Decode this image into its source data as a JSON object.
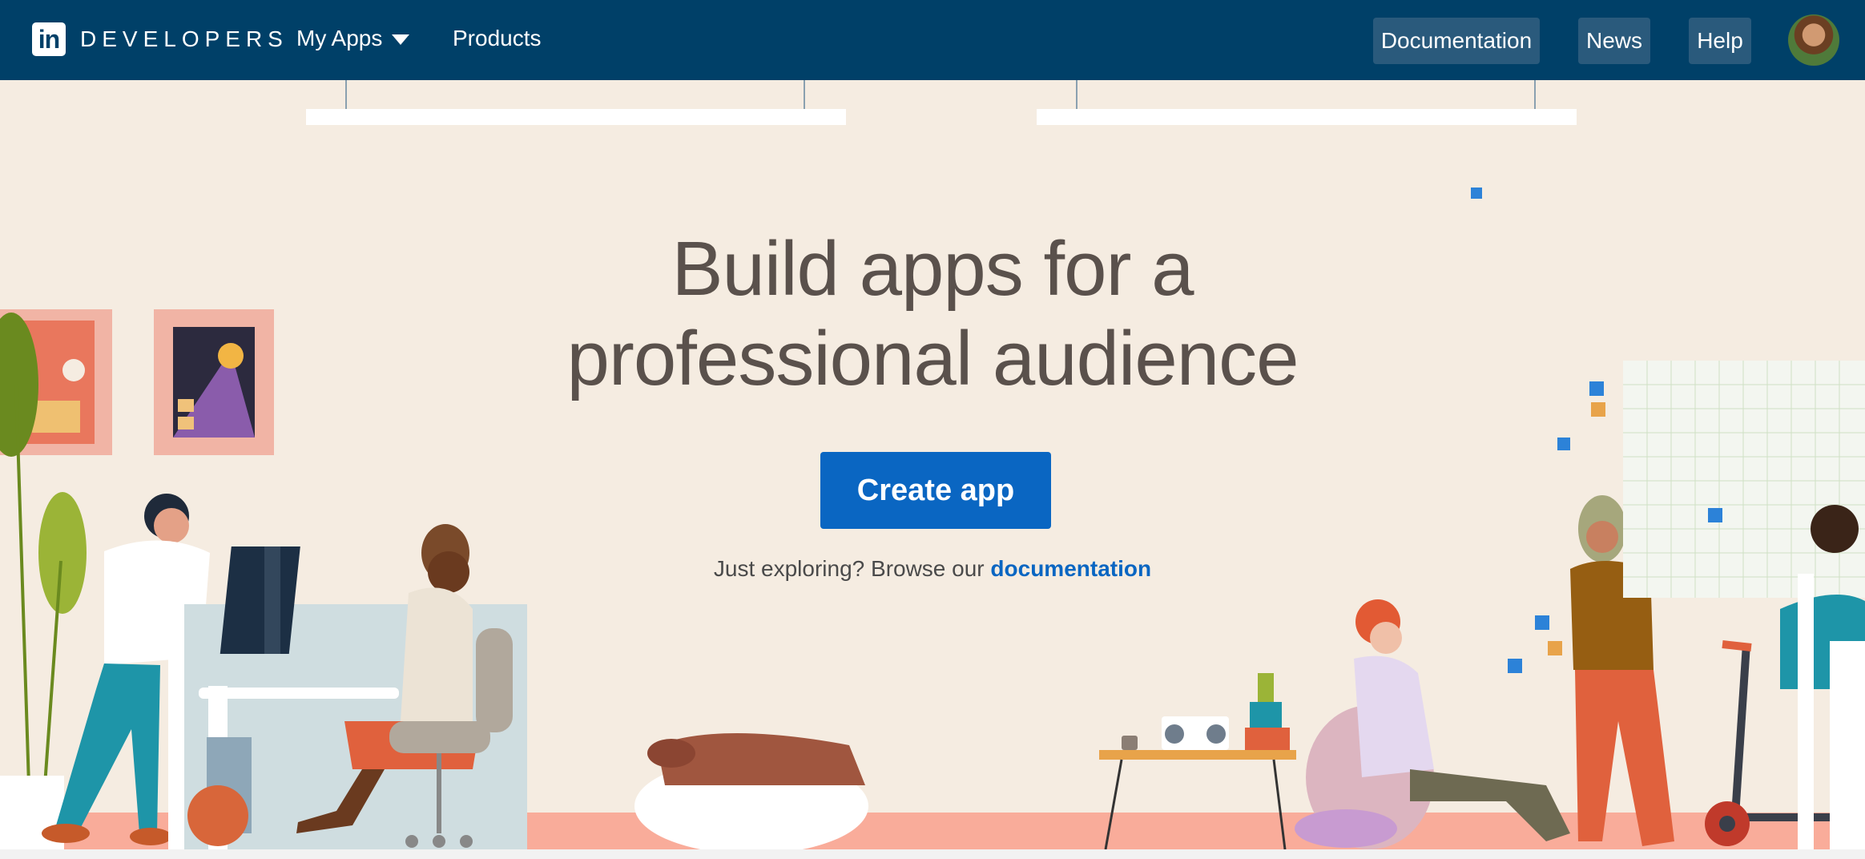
{
  "nav": {
    "logo_mark": "in",
    "brand": "DEVELOPERS",
    "my_apps": "My Apps",
    "products": "Products",
    "documentation": "Documentation",
    "news": "News",
    "help": "Help"
  },
  "hero": {
    "headline_line1": "Build apps for a",
    "headline_line2": "professional audience",
    "cta": "Create app",
    "explore_prefix": "Just exploring? Browse our",
    "explore_link": "documentation"
  },
  "colors": {
    "nav_bg": "#004068",
    "nav_button_bg": "#2a5a7c",
    "primary": "#0a66c2",
    "hero_bg": "#f5ece1",
    "headline": "#5a514c"
  },
  "icons": {
    "logo": "linkedin-logo-icon",
    "my_apps_caret": "caret-down-icon",
    "avatar": "user-avatar"
  }
}
